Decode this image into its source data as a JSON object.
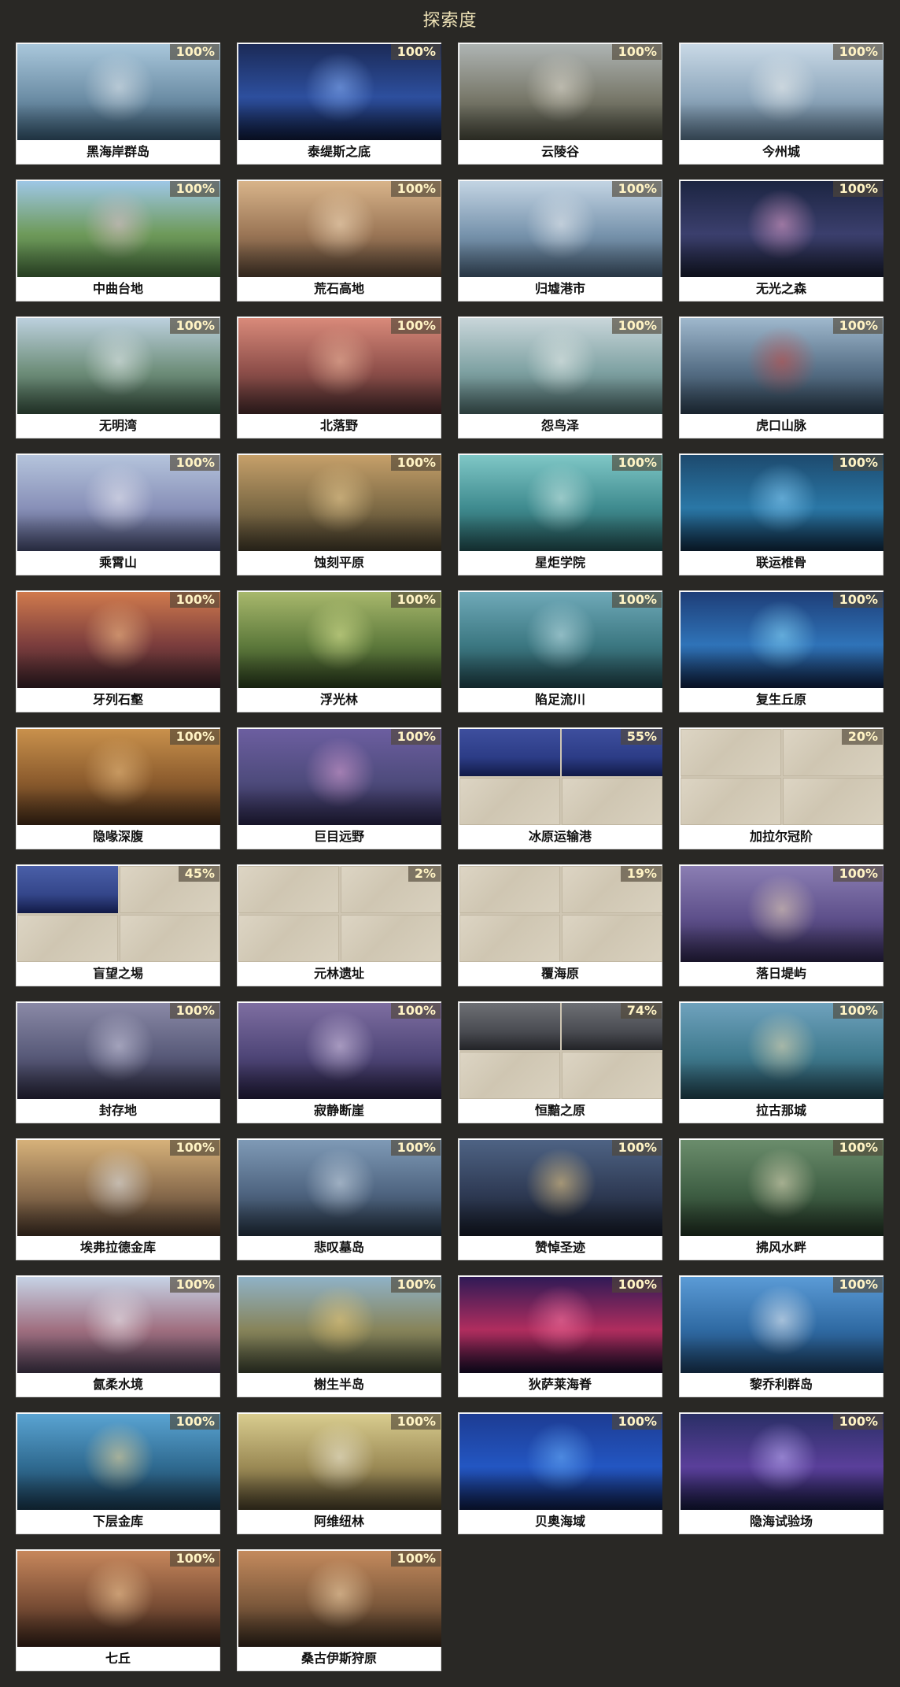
{
  "title": "探索度",
  "regions": [
    {
      "name": "黑海岸群岛",
      "progress": "100%",
      "theme": [
        "#a9c7db",
        "#6e8fa7",
        "#2f4d63",
        "#e9eef2"
      ]
    },
    {
      "name": "泰缇斯之底",
      "progress": "100%",
      "theme": [
        "#1b2a57",
        "#2d4f9e",
        "#0c1530",
        "#8fb8ff"
      ]
    },
    {
      "name": "云陵谷",
      "progress": "100%",
      "theme": [
        "#aeb4b3",
        "#7a7a6c",
        "#3f4034",
        "#e9e4d8"
      ]
    },
    {
      "name": "今州城",
      "progress": "100%",
      "theme": [
        "#c9d9e6",
        "#8fa8bd",
        "#4c6478",
        "#f3f4f2"
      ]
    },
    {
      "name": "中曲台地",
      "progress": "100%",
      "theme": [
        "#9ec7e6",
        "#6e9a5a",
        "#3c5f34",
        "#e8c3d6"
      ]
    },
    {
      "name": "荒石高地",
      "progress": "100%",
      "theme": [
        "#d8b48a",
        "#9b7656",
        "#4b3a2c",
        "#fde6c6"
      ]
    },
    {
      "name": "归墟港市",
      "progress": "100%",
      "theme": [
        "#c3d4e3",
        "#7894ad",
        "#3e5368",
        "#f1f3f6"
      ]
    },
    {
      "name": "无光之森",
      "progress": "100%",
      "theme": [
        "#1c2542",
        "#3b3f6d",
        "#141829",
        "#f0a9d3"
      ]
    },
    {
      "name": "无明湾",
      "progress": "100%",
      "theme": [
        "#bcd0de",
        "#6f8f7b",
        "#324a3a",
        "#eef3f6"
      ]
    },
    {
      "name": "北落野",
      "progress": "100%",
      "theme": [
        "#d98a7a",
        "#8e4f4a",
        "#3e2526",
        "#f7c1a5"
      ]
    },
    {
      "name": "怨鸟泽",
      "progress": "100%",
      "theme": [
        "#c9d6da",
        "#7fa2a3",
        "#415b5a",
        "#f0f3f1"
      ]
    },
    {
      "name": "虎口山脉",
      "progress": "100%",
      "theme": [
        "#9fb8cd",
        "#566f86",
        "#263645",
        "#c8473f"
      ]
    },
    {
      "name": "乘霄山",
      "progress": "100%",
      "theme": [
        "#b5c4dc",
        "#8890b8",
        "#3c4160",
        "#f1f0f6"
      ]
    },
    {
      "name": "蚀刻平原",
      "progress": "100%",
      "theme": [
        "#c6a06a",
        "#7d6a45",
        "#3a3324",
        "#f3d59a"
      ]
    },
    {
      "name": "星炬学院",
      "progress": "100%",
      "theme": [
        "#7fc7c6",
        "#3f8b8f",
        "#1d4547",
        "#d9f2ee"
      ]
    },
    {
      "name": "联运椎骨",
      "progress": "100%",
      "theme": [
        "#1d4a6e",
        "#2a77a6",
        "#0d2236",
        "#8fd6ff"
      ]
    },
    {
      "name": "牙列石壑",
      "progress": "100%",
      "theme": [
        "#d07a4d",
        "#7b3d3d",
        "#2f1c22",
        "#ffc98f"
      ]
    },
    {
      "name": "浮光林",
      "progress": "100%",
      "theme": [
        "#a8b86c",
        "#5e7a3c",
        "#243419",
        "#e6ef9b"
      ]
    },
    {
      "name": "陷足流川",
      "progress": "100%",
      "theme": [
        "#6fa9b8",
        "#3c7882",
        "#1b3a40",
        "#cdebf1"
      ]
    },
    {
      "name": "复生丘原",
      "progress": "100%",
      "theme": [
        "#1e3e78",
        "#2f73b8",
        "#0c1a36",
        "#8fe0ff"
      ]
    },
    {
      "name": "隐喙深腹",
      "progress": "100%",
      "theme": [
        "#c9914c",
        "#8b5b2d",
        "#3b2615",
        "#efc386"
      ]
    },
    {
      "name": "巨目远野",
      "progress": "100%",
      "theme": [
        "#6c5ea0",
        "#4e4b7c",
        "#231f3d",
        "#e3a6d9"
      ]
    },
    {
      "name": "冰原运输港",
      "progress": "55%",
      "locked": [
        true,
        true,
        false,
        false
      ],
      "theme": [
        "#3e4f9e",
        "#2c3c86",
        "#111a46",
        "#b9d4ff"
      ]
    },
    {
      "name": "加拉尔冠阶",
      "progress": "20%",
      "locked": [
        false,
        false,
        false,
        false
      ],
      "theme": [
        "#d9d1bf",
        "#cfc6b2",
        "#c1b7a2",
        "#e6dfcf"
      ]
    },
    {
      "name": "盲望之埸",
      "progress": "45%",
      "locked": [
        true,
        false,
        false,
        false
      ],
      "theme": [
        "#4a5fa8",
        "#34468a",
        "#121a46",
        "#aebcf2"
      ]
    },
    {
      "name": "元林遗址",
      "progress": "2%",
      "locked": [
        false,
        false,
        false,
        false
      ],
      "theme": [
        "#d9d1bf",
        "#cfc6b2",
        "#c1b7a2",
        "#e6dfcf"
      ]
    },
    {
      "name": "覆海原",
      "progress": "19%",
      "locked": [
        false,
        false,
        false,
        false
      ],
      "theme": [
        "#d9d1bf",
        "#cfc6b2",
        "#c1b7a2",
        "#e6dfcf"
      ]
    },
    {
      "name": "落日堤屿",
      "progress": "100%",
      "theme": [
        "#8b7eb3",
        "#5d4f8a",
        "#261f3f",
        "#f2ddbc"
      ]
    },
    {
      "name": "封存地",
      "progress": "100%",
      "theme": [
        "#8a89a6",
        "#585a79",
        "#242235",
        "#d8d6ea"
      ]
    },
    {
      "name": "寂静断崖",
      "progress": "100%",
      "theme": [
        "#7e6ea1",
        "#4f4678",
        "#1f1a36",
        "#e7d7f3"
      ]
    },
    {
      "name": "恒黯之原",
      "progress": "74%",
      "locked": [
        true,
        true,
        false,
        false
      ],
      "theme": [
        "#6d6f74",
        "#4a4c52",
        "#222327",
        "#b9b9bb"
      ]
    },
    {
      "name": "拉古那城",
      "progress": "100%",
      "theme": [
        "#6fa2bd",
        "#3f7a8e",
        "#1c3a45",
        "#f2e2b6"
      ]
    },
    {
      "name": "埃弗拉德金库",
      "progress": "100%",
      "theme": [
        "#d7b27a",
        "#8a6c4d",
        "#3c2d22",
        "#e9f0f7"
      ]
    },
    {
      "name": "悲叹墓岛",
      "progress": "100%",
      "theme": [
        "#7f9ab6",
        "#4f6581",
        "#202c3a",
        "#d7e3ee"
      ]
    },
    {
      "name": "赞悼圣迹",
      "progress": "100%",
      "theme": [
        "#4e6384",
        "#2f3b55",
        "#121722",
        "#ffd98a"
      ]
    },
    {
      "name": "拂风水畔",
      "progress": "100%",
      "theme": [
        "#6b8d6c",
        "#3f5f44",
        "#1c2a1d",
        "#f1e8c7"
      ]
    },
    {
      "name": "氤柔水境",
      "progress": "100%",
      "theme": [
        "#c6d3e6",
        "#a06f80",
        "#3e3346",
        "#f3f4f8"
      ]
    },
    {
      "name": "榭生半岛",
      "progress": "100%",
      "theme": [
        "#8fb2c7",
        "#87845a",
        "#343a2a",
        "#f2cf7a"
      ]
    },
    {
      "name": "狄萨莱海脊",
      "progress": "100%",
      "theme": [
        "#2f1a56",
        "#b02d5e",
        "#120a23",
        "#ff7aa5"
      ]
    },
    {
      "name": "黎乔利群岛",
      "progress": "100%",
      "theme": [
        "#5b9bd6",
        "#2f6aa3",
        "#16324f",
        "#ffffff"
      ]
    },
    {
      "name": "下层金库",
      "progress": "100%",
      "theme": [
        "#5aa4d3",
        "#2f6a90",
        "#152f42",
        "#ffe09a"
      ]
    },
    {
      "name": "阿维纽林",
      "progress": "100%",
      "theme": [
        "#d9cd8f",
        "#9b8a55",
        "#3d3522",
        "#f6f2e2"
      ]
    },
    {
      "name": "贝奥海域",
      "progress": "100%",
      "theme": [
        "#1d3c93",
        "#2356c2",
        "#0b1638",
        "#6fb6ff"
      ]
    },
    {
      "name": "隐海试验场",
      "progress": "100%",
      "theme": [
        "#2a2f66",
        "#5a3f9a",
        "#0f1330",
        "#c8b8ff"
      ]
    },
    {
      "name": "七丘",
      "progress": "100%",
      "theme": [
        "#c7875c",
        "#7c4f36",
        "#2e1d15",
        "#ffd6a2"
      ]
    },
    {
      "name": "桑古伊斯狩原",
      "progress": "100%",
      "theme": [
        "#c48a5d",
        "#7e5a3c",
        "#2d2218",
        "#ffe1b6"
      ]
    }
  ]
}
